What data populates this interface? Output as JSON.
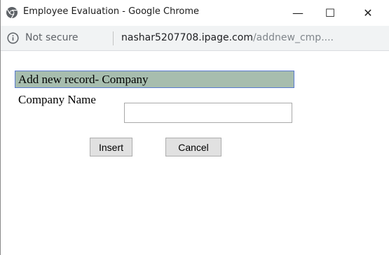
{
  "window": {
    "title": "Employee Evaluation - Google Chrome",
    "minimize_label": "—",
    "maximize_label": "☐",
    "close_label": "✕"
  },
  "addressbar": {
    "security_text": "Not secure",
    "url_host": "nashar5207708.ipage.com",
    "url_path": "/addnew_cmp...."
  },
  "icons": {
    "browser_icon": "chrome-icon",
    "info_icon": "info-icon"
  },
  "form": {
    "header": "Add new record- Company",
    "company_name_label": "Company Name",
    "company_name_value": "",
    "insert_label": "Insert",
    "cancel_label": "Cancel"
  },
  "colors": {
    "header_bg": "#a7bdae",
    "header_border": "#5a7bd0",
    "button_bg": "#e1e1e1"
  }
}
